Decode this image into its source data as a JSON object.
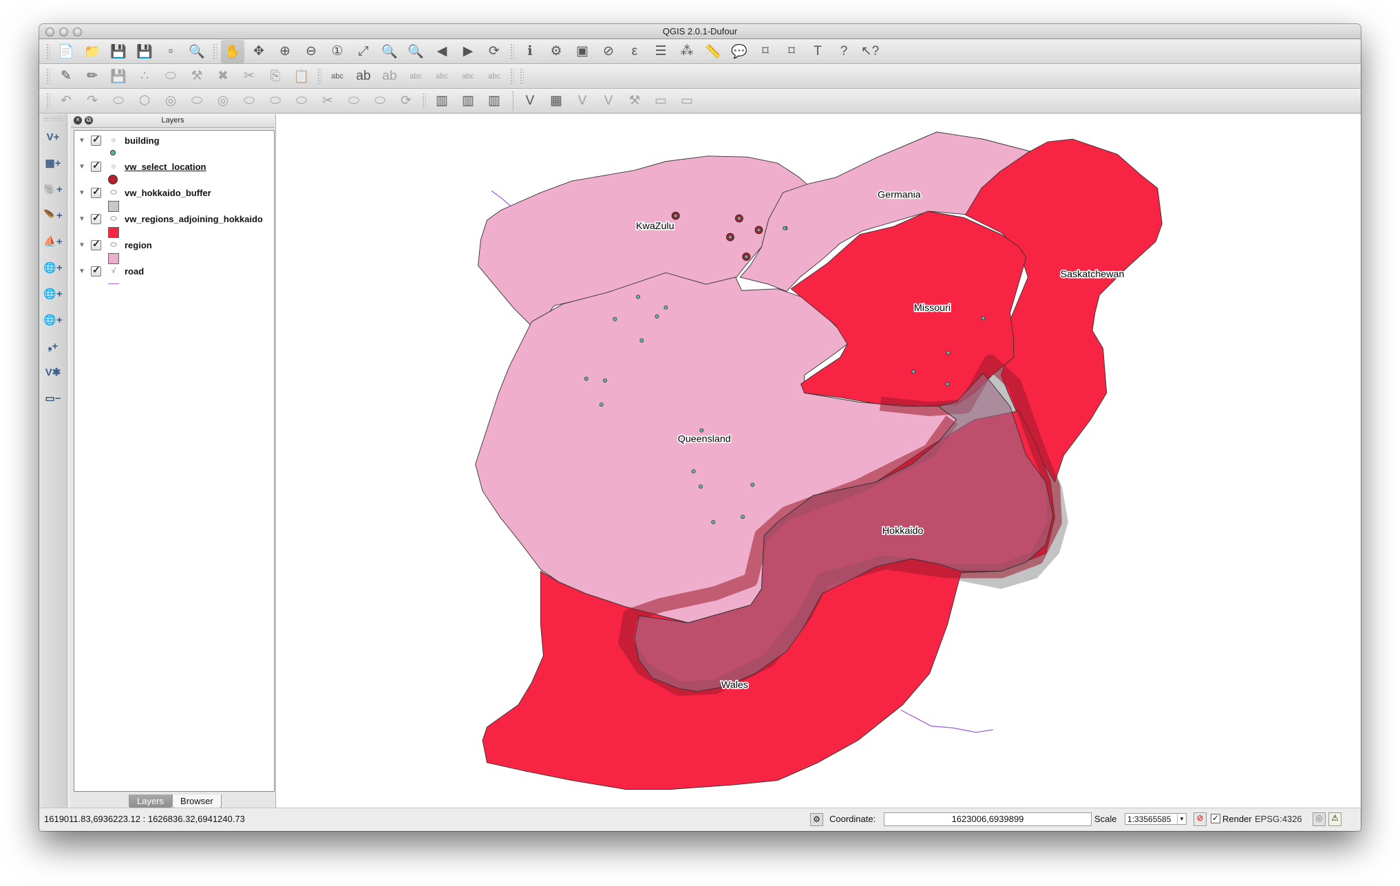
{
  "window": {
    "title": "QGIS 2.0.1-Dufour"
  },
  "toolbars": {
    "file": [
      {
        "name": "new-project-icon",
        "glyph": "📄"
      },
      {
        "name": "open-project-icon",
        "glyph": "📁"
      },
      {
        "name": "save-project-icon",
        "glyph": "💾"
      },
      {
        "name": "save-as-icon",
        "glyph": "💾"
      },
      {
        "name": "new-print-composer-icon",
        "glyph": "▫"
      },
      {
        "name": "composer-manager-icon",
        "glyph": "🔍"
      }
    ],
    "navigation": [
      {
        "name": "pan-icon",
        "glyph": "✋",
        "active": true
      },
      {
        "name": "pan-to-selection-icon",
        "glyph": "✥"
      },
      {
        "name": "zoom-in-icon",
        "glyph": "⊕"
      },
      {
        "name": "zoom-out-icon",
        "glyph": "⊖"
      },
      {
        "name": "zoom-actual-size-icon",
        "glyph": "①"
      },
      {
        "name": "zoom-full-icon",
        "glyph": "⤢"
      },
      {
        "name": "zoom-to-selection-icon",
        "glyph": "🔍"
      },
      {
        "name": "zoom-to-layer-icon",
        "glyph": "🔍"
      },
      {
        "name": "zoom-last-icon",
        "glyph": "◀"
      },
      {
        "name": "zoom-next-icon",
        "glyph": "▶"
      },
      {
        "name": "refresh-icon",
        "glyph": "⟳"
      }
    ],
    "attributes": [
      {
        "name": "identify-icon",
        "glyph": "ℹ"
      },
      {
        "name": "run-action-icon",
        "glyph": "⚙"
      },
      {
        "name": "select-features-icon",
        "glyph": "▣"
      },
      {
        "name": "deselect-all-icon",
        "glyph": "⊘"
      },
      {
        "name": "select-by-expression-icon",
        "glyph": "ε"
      },
      {
        "name": "open-attribute-table-icon",
        "glyph": "☰"
      },
      {
        "name": "field-calculator-icon",
        "glyph": "⁂"
      },
      {
        "name": "measure-line-icon",
        "glyph": "📏"
      },
      {
        "name": "map-tips-icon",
        "glyph": "💬"
      },
      {
        "name": "new-bookmark-icon",
        "glyph": "⌑"
      },
      {
        "name": "show-bookmarks-icon",
        "glyph": "⌑"
      },
      {
        "name": "text-annotation-icon",
        "glyph": "T"
      },
      {
        "name": "help-contents-icon",
        "glyph": "?"
      },
      {
        "name": "whats-this-icon",
        "glyph": "↖?"
      }
    ],
    "digitizing": [
      {
        "name": "current-edits-icon",
        "glyph": "✎"
      },
      {
        "name": "toggle-editing-icon",
        "glyph": "✏"
      },
      {
        "name": "save-layer-edits-icon",
        "glyph": "💾"
      },
      {
        "name": "add-feature-icon",
        "glyph": "∴"
      },
      {
        "name": "move-feature-icon",
        "glyph": "⬭"
      },
      {
        "name": "node-tool-icon",
        "glyph": "⚒"
      },
      {
        "name": "delete-selected-icon",
        "glyph": "✖"
      },
      {
        "name": "cut-features-icon",
        "glyph": "✂"
      },
      {
        "name": "copy-features-icon",
        "glyph": "⎘"
      },
      {
        "name": "paste-features-icon",
        "glyph": "📋"
      }
    ],
    "labels": [
      {
        "name": "layer-labeling-icon",
        "glyph": "abc"
      },
      {
        "name": "pin-labels-icon",
        "glyph": "ab"
      },
      {
        "name": "highlight-pinned-labels-icon",
        "glyph": "ab"
      },
      {
        "name": "show-hide-labels-icon",
        "glyph": "abc"
      },
      {
        "name": "move-label-icon",
        "glyph": "abc"
      },
      {
        "name": "rotate-label-icon",
        "glyph": "abc"
      },
      {
        "name": "change-label-icon",
        "glyph": "abc"
      }
    ],
    "advanced_digitizing": [
      {
        "name": "undo-icon",
        "glyph": "↶"
      },
      {
        "name": "redo-icon",
        "glyph": "↷"
      },
      {
        "name": "rotate-feature-icon",
        "glyph": "⬭"
      },
      {
        "name": "simplify-feature-icon",
        "glyph": "⬡"
      },
      {
        "name": "add-ring-icon",
        "glyph": "◎"
      },
      {
        "name": "add-part-icon",
        "glyph": "⬭"
      },
      {
        "name": "delete-ring-icon",
        "glyph": "◎"
      },
      {
        "name": "delete-part-icon",
        "glyph": "⬭"
      },
      {
        "name": "reshape-features-icon",
        "glyph": "⬭"
      },
      {
        "name": "offset-curve-icon",
        "glyph": "⬭"
      },
      {
        "name": "split-features-icon",
        "glyph": "✂"
      },
      {
        "name": "merge-selected-icon",
        "glyph": "⬭"
      },
      {
        "name": "merge-attributes-icon",
        "glyph": "⬭"
      },
      {
        "name": "rotate-point-symbols-icon",
        "glyph": "⟳"
      }
    ],
    "gps_raster": [
      {
        "name": "gps-upload-icon",
        "glyph": "▥"
      },
      {
        "name": "gps-new-icon",
        "glyph": "▥"
      },
      {
        "name": "gps-delete-icon",
        "glyph": "▥"
      }
    ],
    "grass": [
      {
        "name": "grass-add-vector-icon",
        "glyph": "V"
      },
      {
        "name": "grass-add-raster-icon",
        "glyph": "▦"
      },
      {
        "name": "grass-new-vector-icon",
        "glyph": "V"
      },
      {
        "name": "grass-edit-vector-icon",
        "glyph": "V"
      },
      {
        "name": "grass-tools-icon",
        "glyph": "⚒"
      },
      {
        "name": "grass-region-icon",
        "glyph": "▭"
      },
      {
        "name": "grass-edit-region-icon",
        "glyph": "▭"
      }
    ]
  },
  "left_toolbar": [
    {
      "name": "add-vector-layer-icon",
      "glyph": "V+"
    },
    {
      "name": "add-raster-layer-icon",
      "glyph": "▦+"
    },
    {
      "name": "add-postgis-layer-icon",
      "glyph": "🐘+"
    },
    {
      "name": "add-spatialite-layer-icon",
      "glyph": "🪶+"
    },
    {
      "name": "add-mssql-layer-icon",
      "glyph": "⛵+"
    },
    {
      "name": "add-wms-layer-icon",
      "glyph": "🌐+"
    },
    {
      "name": "add-wcs-layer-icon",
      "glyph": "🌐+"
    },
    {
      "name": "add-wfs-layer-icon",
      "glyph": "🌐+"
    },
    {
      "name": "add-delimited-text-layer-icon",
      "glyph": "❟+"
    },
    {
      "name": "new-shapefile-layer-icon",
      "glyph": "V✱"
    },
    {
      "name": "remove-layer-icon",
      "glyph": "▭−"
    }
  ],
  "layers_panel": {
    "title": "Layers",
    "layers": [
      {
        "name": "building",
        "type": "point",
        "checked": true,
        "underlined": false,
        "symbol": {
          "kind": "small-circle",
          "fill": "#5bb5a8"
        }
      },
      {
        "name": "vw_select_location",
        "type": "point",
        "checked": true,
        "underlined": true,
        "symbol": {
          "kind": "circle",
          "fill": "#b5202a"
        }
      },
      {
        "name": "vw_hokkaido_buffer",
        "type": "polygon",
        "checked": true,
        "underlined": false,
        "symbol": {
          "kind": "square",
          "fill": "#c8c8c8"
        }
      },
      {
        "name": "vw_regions_adjoining_hokkaido",
        "type": "polygon",
        "checked": true,
        "underlined": false,
        "symbol": {
          "kind": "square",
          "fill": "#f72442"
        }
      },
      {
        "name": "region",
        "type": "polygon",
        "checked": true,
        "underlined": false,
        "symbol": {
          "kind": "square",
          "fill": "#efadcc"
        }
      },
      {
        "name": "road",
        "type": "line",
        "checked": true,
        "underlined": false,
        "symbol": {
          "kind": "line",
          "fill": "#a865e0"
        }
      }
    ],
    "tabs": [
      {
        "label": "Layers",
        "active": true
      },
      {
        "label": "Browser",
        "active": false
      }
    ]
  },
  "map": {
    "colors": {
      "region_fill": "#efaecb",
      "adjoining_fill": "#f82443",
      "buffer_fill": "#a0a0a0",
      "hokkaido_overlay": "#b9879e",
      "road": "#a060e8",
      "building": "#5bb5a8",
      "selected": "#b5202a"
    },
    "labels": [
      "KwaZulu",
      "Germania",
      "Saskatchewan",
      "Missouri",
      "Queensland",
      "Hokkaido",
      "Wales"
    ]
  },
  "statusbar": {
    "extent": "1619011.83,6936223.12 : 1626836.32,6941240.73",
    "coordinate_label": "Coordinate:",
    "coordinate_value": "1623006,6939899",
    "scale_label": "Scale",
    "scale_value": "1:33565585",
    "render_label": "Render",
    "render_checked": true,
    "crs": "EPSG:4326"
  }
}
